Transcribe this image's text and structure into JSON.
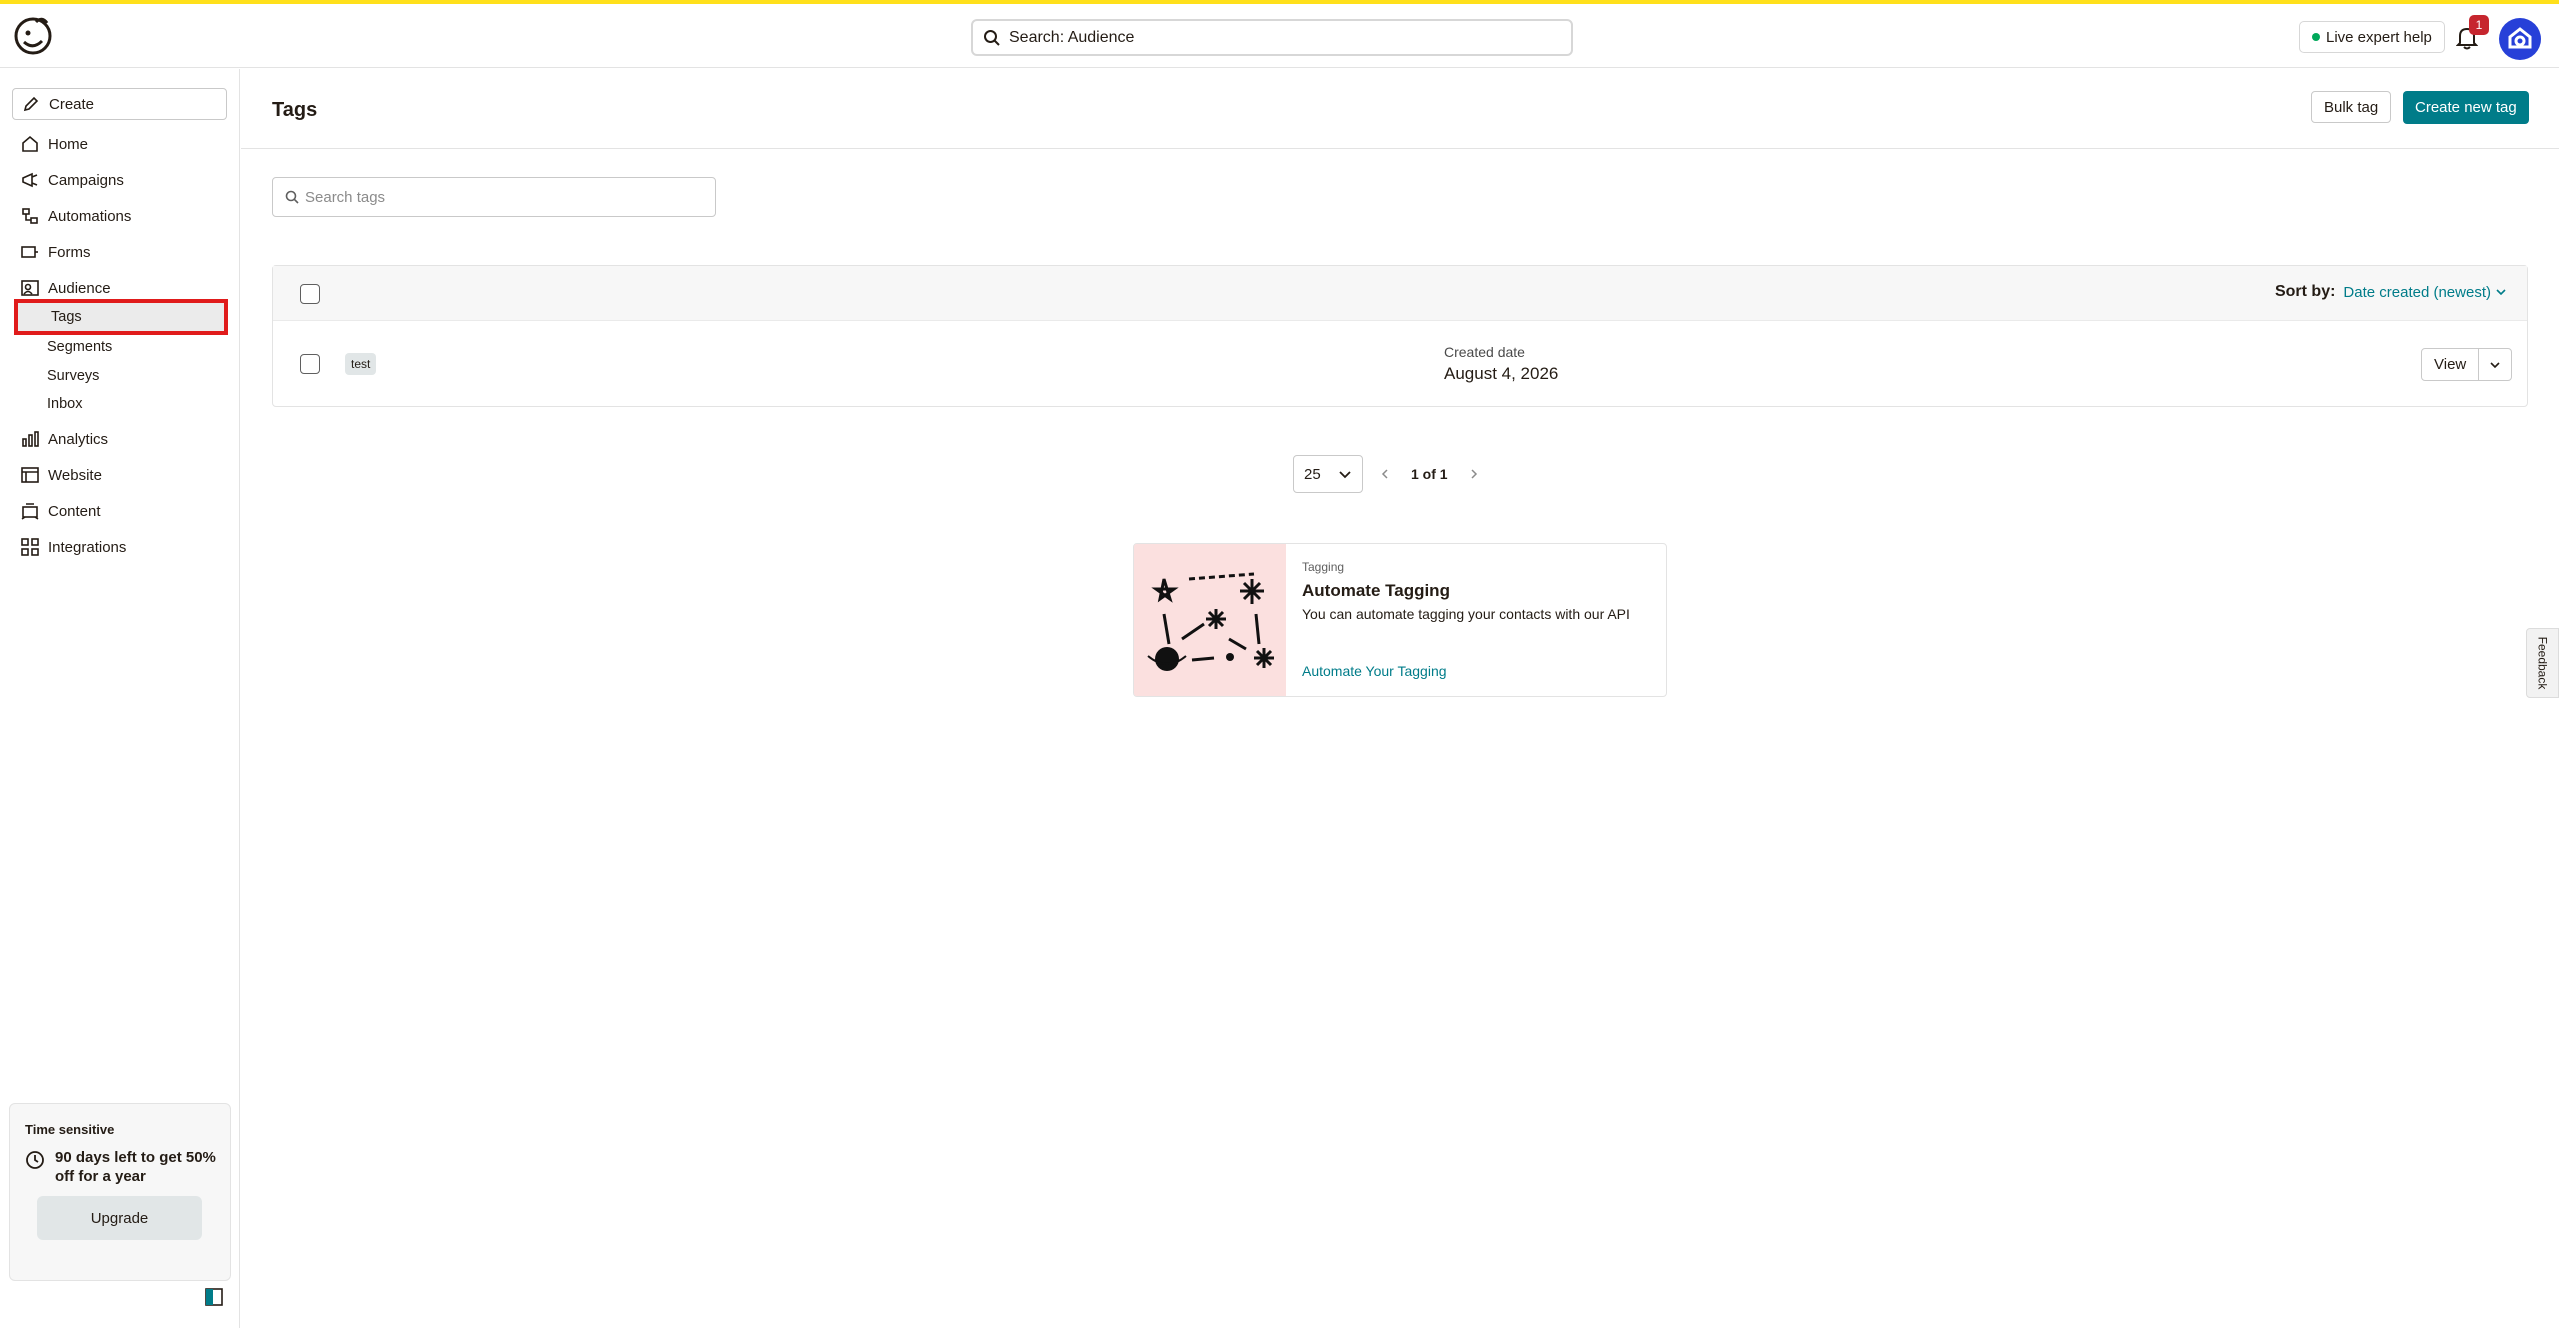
{
  "header": {
    "search_label": "Search: Audience",
    "expert_help": "Live expert help",
    "notification_count": "1"
  },
  "sidebar": {
    "create_label": "Create",
    "items": [
      {
        "label": "Home",
        "icon": "home-icon"
      },
      {
        "label": "Campaigns",
        "icon": "megaphone-icon"
      },
      {
        "label": "Automations",
        "icon": "automation-icon"
      },
      {
        "label": "Forms",
        "icon": "form-icon"
      },
      {
        "label": "Audience",
        "icon": "audience-icon"
      }
    ],
    "sub_items": [
      "Tags",
      "Segments",
      "Surveys",
      "Inbox"
    ],
    "items_after": [
      {
        "label": "Analytics",
        "icon": "chart-icon"
      },
      {
        "label": "Website",
        "icon": "website-icon"
      },
      {
        "label": "Content",
        "icon": "content-icon"
      },
      {
        "label": "Integrations",
        "icon": "grid-icon"
      }
    ],
    "promo": {
      "title": "Time sensitive",
      "text": "90 days left to get 50% off for a year",
      "button": "Upgrade"
    }
  },
  "main": {
    "title": "Tags",
    "bulk_tag": "Bulk tag",
    "create_new_tag": "Create new tag",
    "search_placeholder": "Search tags",
    "sort_label": "Sort by:",
    "sort_value": "Date created (newest)",
    "rows": [
      {
        "tag": "test",
        "created_label": "Created date",
        "created_value": "August 4, 2026",
        "action": "View"
      }
    ],
    "page_size": "25",
    "page_text": "1 of 1"
  },
  "card": {
    "kicker": "Tagging",
    "title": "Automate Tagging",
    "description": "You can automate tagging your contacts with our API",
    "link": "Automate Your Tagging"
  },
  "feedback": "Feedback",
  "colors": {
    "accent_yellow": "#ffe01b",
    "primary_teal": "#007c89",
    "highlight_red": "#e01b1b",
    "badge_red": "#c6262e",
    "avatar_blue": "#2740d8"
  }
}
